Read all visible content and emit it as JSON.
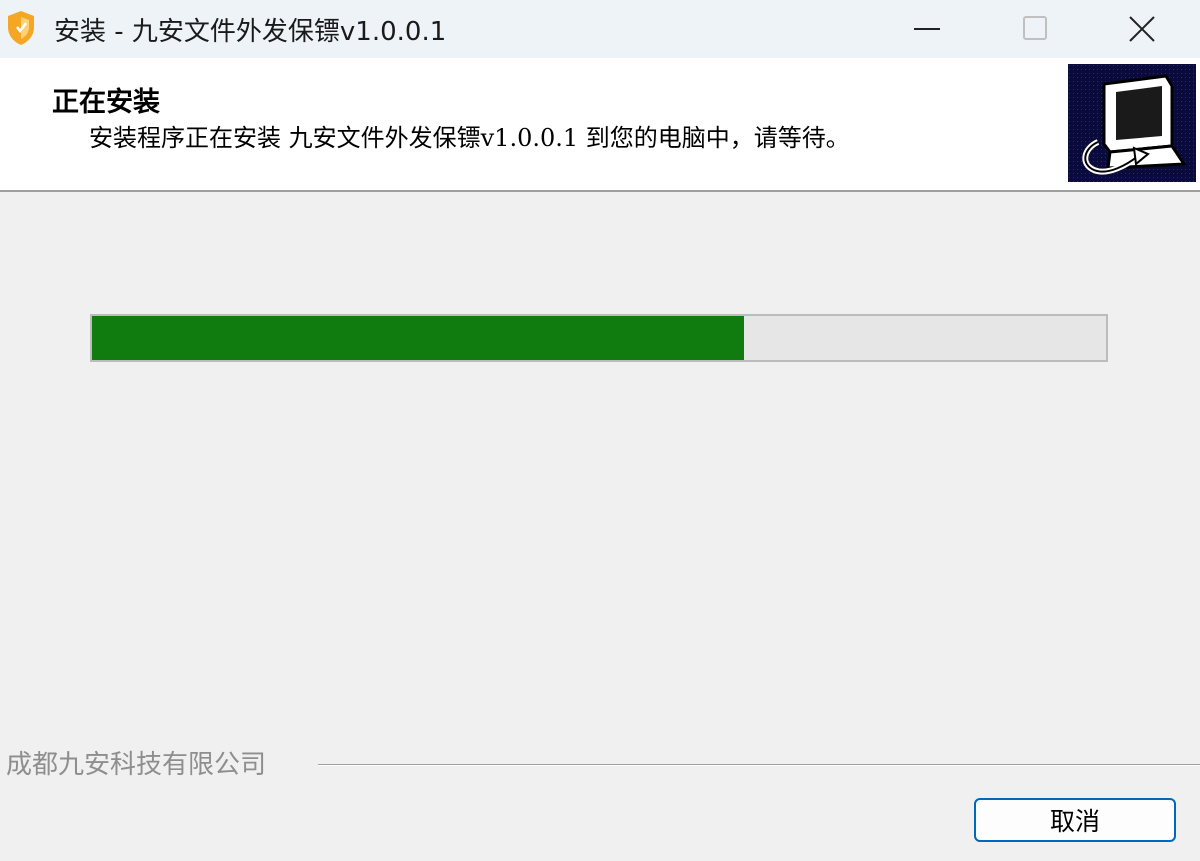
{
  "window": {
    "title": "安装 - 九安文件外发保镖v1.0.0.1",
    "icon": "shield-icon",
    "controls": [
      "minimize-icon",
      "maximize-icon",
      "close-icon"
    ]
  },
  "header": {
    "title": "正在安装",
    "subtitle": "安装程序正在安装 九安文件外发保镖v1.0.0.1 到您的电脑中，请等待。",
    "image": "computer-install-icon"
  },
  "progress": {
    "percent": 64.3,
    "color": "#107c10"
  },
  "footer": {
    "company": "成都九安科技有限公司",
    "cancel_label": "取消"
  },
  "colors": {
    "accent": "#0067c0",
    "icon": "#f5a623"
  }
}
